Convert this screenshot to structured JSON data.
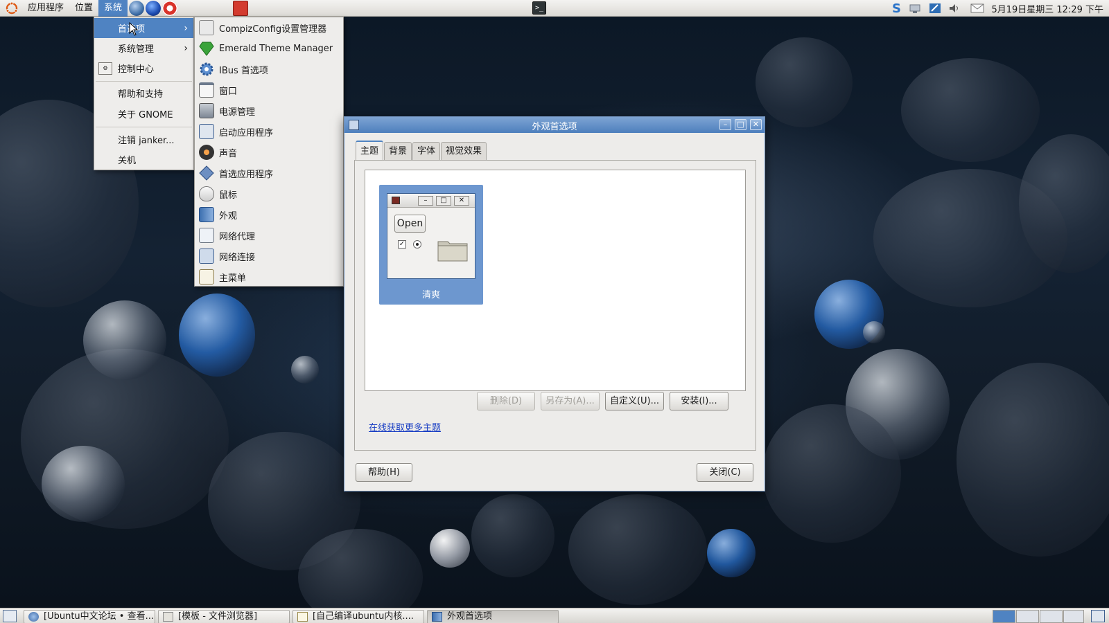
{
  "top_panel": {
    "menus": [
      "应用程序",
      "位置",
      "系统"
    ],
    "active_menu": "系统",
    "launchers": [
      "ubuntu-browser-icon",
      "firefox-icon",
      "help-icon",
      "dictionary-icon"
    ],
    "terminal": "terminal-icon",
    "clock": "5月19日星期三 12:29 下午"
  },
  "system_menu": {
    "items": [
      {
        "label": "首选项",
        "has_submenu": true,
        "highlighted": true
      },
      {
        "label": "系统管理",
        "has_submenu": true
      },
      {
        "label": "控制中心",
        "icon": "control-center-icon"
      },
      {
        "label": "帮助和支持"
      },
      {
        "label": "关于 GNOME"
      },
      {
        "label": "注销 janker..."
      },
      {
        "label": "关机"
      }
    ]
  },
  "preferences_submenu": {
    "items": [
      {
        "label": "CompizConfig设置管理器",
        "icon": "compizconfig-icon"
      },
      {
        "label": "Emerald Theme Manager",
        "icon": "emerald-icon"
      },
      {
        "label": "IBus 首选项",
        "icon": "ibus-gear-icon"
      },
      {
        "label": "窗口",
        "icon": "window-icon"
      },
      {
        "label": "电源管理",
        "icon": "power-icon"
      },
      {
        "label": "启动应用程序",
        "icon": "startup-apps-icon"
      },
      {
        "label": "声音",
        "icon": "sound-icon"
      },
      {
        "label": "首选应用程序",
        "icon": "preferred-apps-icon"
      },
      {
        "label": "鼠标",
        "icon": "mouse-icon"
      },
      {
        "label": "外观",
        "icon": "appearance-icon"
      },
      {
        "label": "网络代理",
        "icon": "network-proxy-icon"
      },
      {
        "label": "网络连接",
        "icon": "network-connection-icon"
      },
      {
        "label": "主菜单",
        "icon": "main-menu-icon"
      }
    ]
  },
  "dialog": {
    "title": "外观首选项",
    "tabs": [
      "主题",
      "背景",
      "字体",
      "视觉效果"
    ],
    "active_tab": "主题",
    "theme": {
      "name": "清爽",
      "preview_button": "Open"
    },
    "buttons": {
      "delete": "删除(D)",
      "save_as": "另存为(A)...",
      "customize": "自定义(U)...",
      "install": "安装(I)..."
    },
    "online_link": "在线获取更多主题",
    "help": "帮助(H)",
    "close": "关闭(C)"
  },
  "taskbar": {
    "tasks": [
      {
        "label": "[Ubuntu中文论坛 • 查看..."
      },
      {
        "label": "[模板 - 文件浏览器]"
      },
      {
        "label": "[自己编译ubuntu内核...."
      },
      {
        "label": "外观首选项",
        "active": true
      }
    ]
  }
}
